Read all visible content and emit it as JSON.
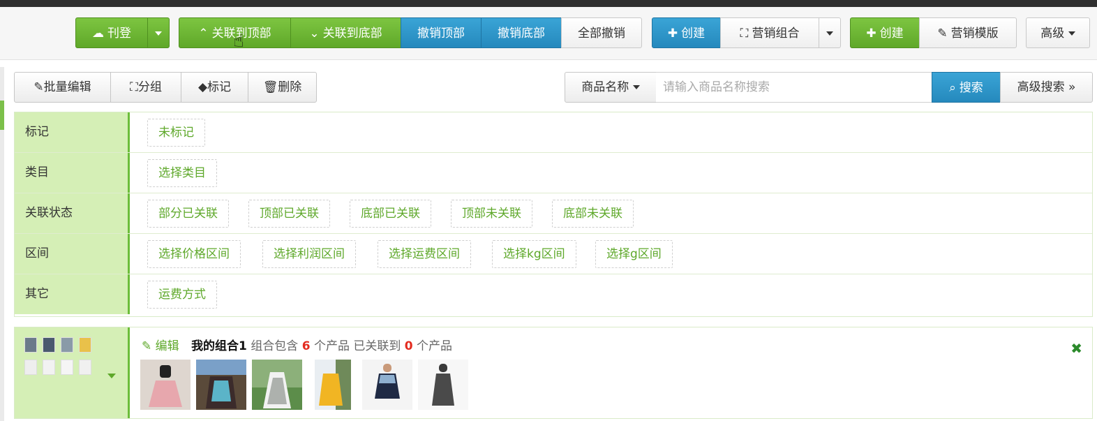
{
  "toolbar": {
    "publish": "刊登",
    "relate_top": "关联到顶部",
    "relate_bottom": "关联到底部",
    "undo_top": "撤销顶部",
    "undo_bottom": "撤销底部",
    "undo_all": "全部撤销",
    "create1": "创建",
    "marketing_group": "营销组合",
    "create2": "创建",
    "marketing_template": "营销模版",
    "advanced": "高级"
  },
  "actions": {
    "batch_edit": "批量编辑",
    "group": "分组",
    "mark": "标记",
    "delete": "删除"
  },
  "search": {
    "field_select": "商品名称",
    "placeholder": "请输入商品名称搜索",
    "button": "搜索",
    "advanced": "高级搜索"
  },
  "filters": [
    {
      "label": "标记",
      "tags": [
        "未标记"
      ]
    },
    {
      "label": "类目",
      "tags": [
        "选择类目"
      ]
    },
    {
      "label": "关联状态",
      "tags": [
        "部分已关联",
        "顶部已关联",
        "底部已关联",
        "顶部未关联",
        "底部未关联"
      ]
    },
    {
      "label": "区间",
      "tags": [
        "选择价格区间",
        "选择利润区间",
        "选择运费区间",
        "选择kg区间",
        "选择g区间"
      ]
    },
    {
      "label": "其它",
      "tags": [
        "运费方式"
      ]
    }
  ],
  "combo": {
    "edit": "编辑",
    "name": "我的组合1",
    "contains_prefix": "组合包含",
    "product_count": "6",
    "contains_suffix": "个产品 已关联到",
    "related_count": "0",
    "related_suffix": "个产品"
  },
  "colors": {
    "green": "#6cbd3a",
    "blue": "#2a8fc4",
    "label_bg": "#d5efb6",
    "tag_text": "#5ea82a",
    "red": "#e32b1f"
  }
}
